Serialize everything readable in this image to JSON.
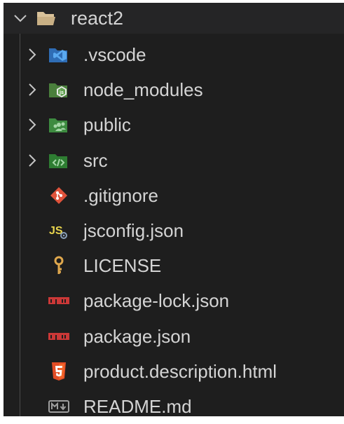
{
  "explorer": {
    "root": {
      "label": "react2",
      "expanded": true,
      "icon": "folder-open-icon"
    },
    "items": [
      {
        "label": ".vscode",
        "type": "folder",
        "icon": "vscode-folder-icon",
        "color": "#3b82d6"
      },
      {
        "label": "node_modules",
        "type": "folder",
        "icon": "nodejs-folder-icon",
        "color": "#5fa04e"
      },
      {
        "label": "public",
        "type": "folder",
        "icon": "public-folder-icon",
        "color": "#4caf50"
      },
      {
        "label": "src",
        "type": "folder",
        "icon": "src-folder-icon",
        "color": "#4caf50"
      },
      {
        "label": ".gitignore",
        "type": "file",
        "icon": "git-icon",
        "color": "#e0533b"
      },
      {
        "label": "jsconfig.json",
        "type": "file",
        "icon": "javascript-config-icon",
        "color": "#e8d44d"
      },
      {
        "label": "LICENSE",
        "type": "file",
        "icon": "license-key-icon",
        "color": "#e0a84d"
      },
      {
        "label": "package-lock.json",
        "type": "file",
        "icon": "npm-icon",
        "color": "#cb3837"
      },
      {
        "label": "package.json",
        "type": "file",
        "icon": "npm-icon",
        "color": "#cb3837"
      },
      {
        "label": "product.description.html",
        "type": "file",
        "icon": "html5-icon",
        "color": "#e44d26"
      },
      {
        "label": "README.md",
        "type": "file",
        "icon": "markdown-icon",
        "color": "#9e9e9e"
      }
    ],
    "colors": {
      "background": "#1e1e1e",
      "root_row_background": "#252526",
      "text": "#d4d4d4"
    }
  }
}
